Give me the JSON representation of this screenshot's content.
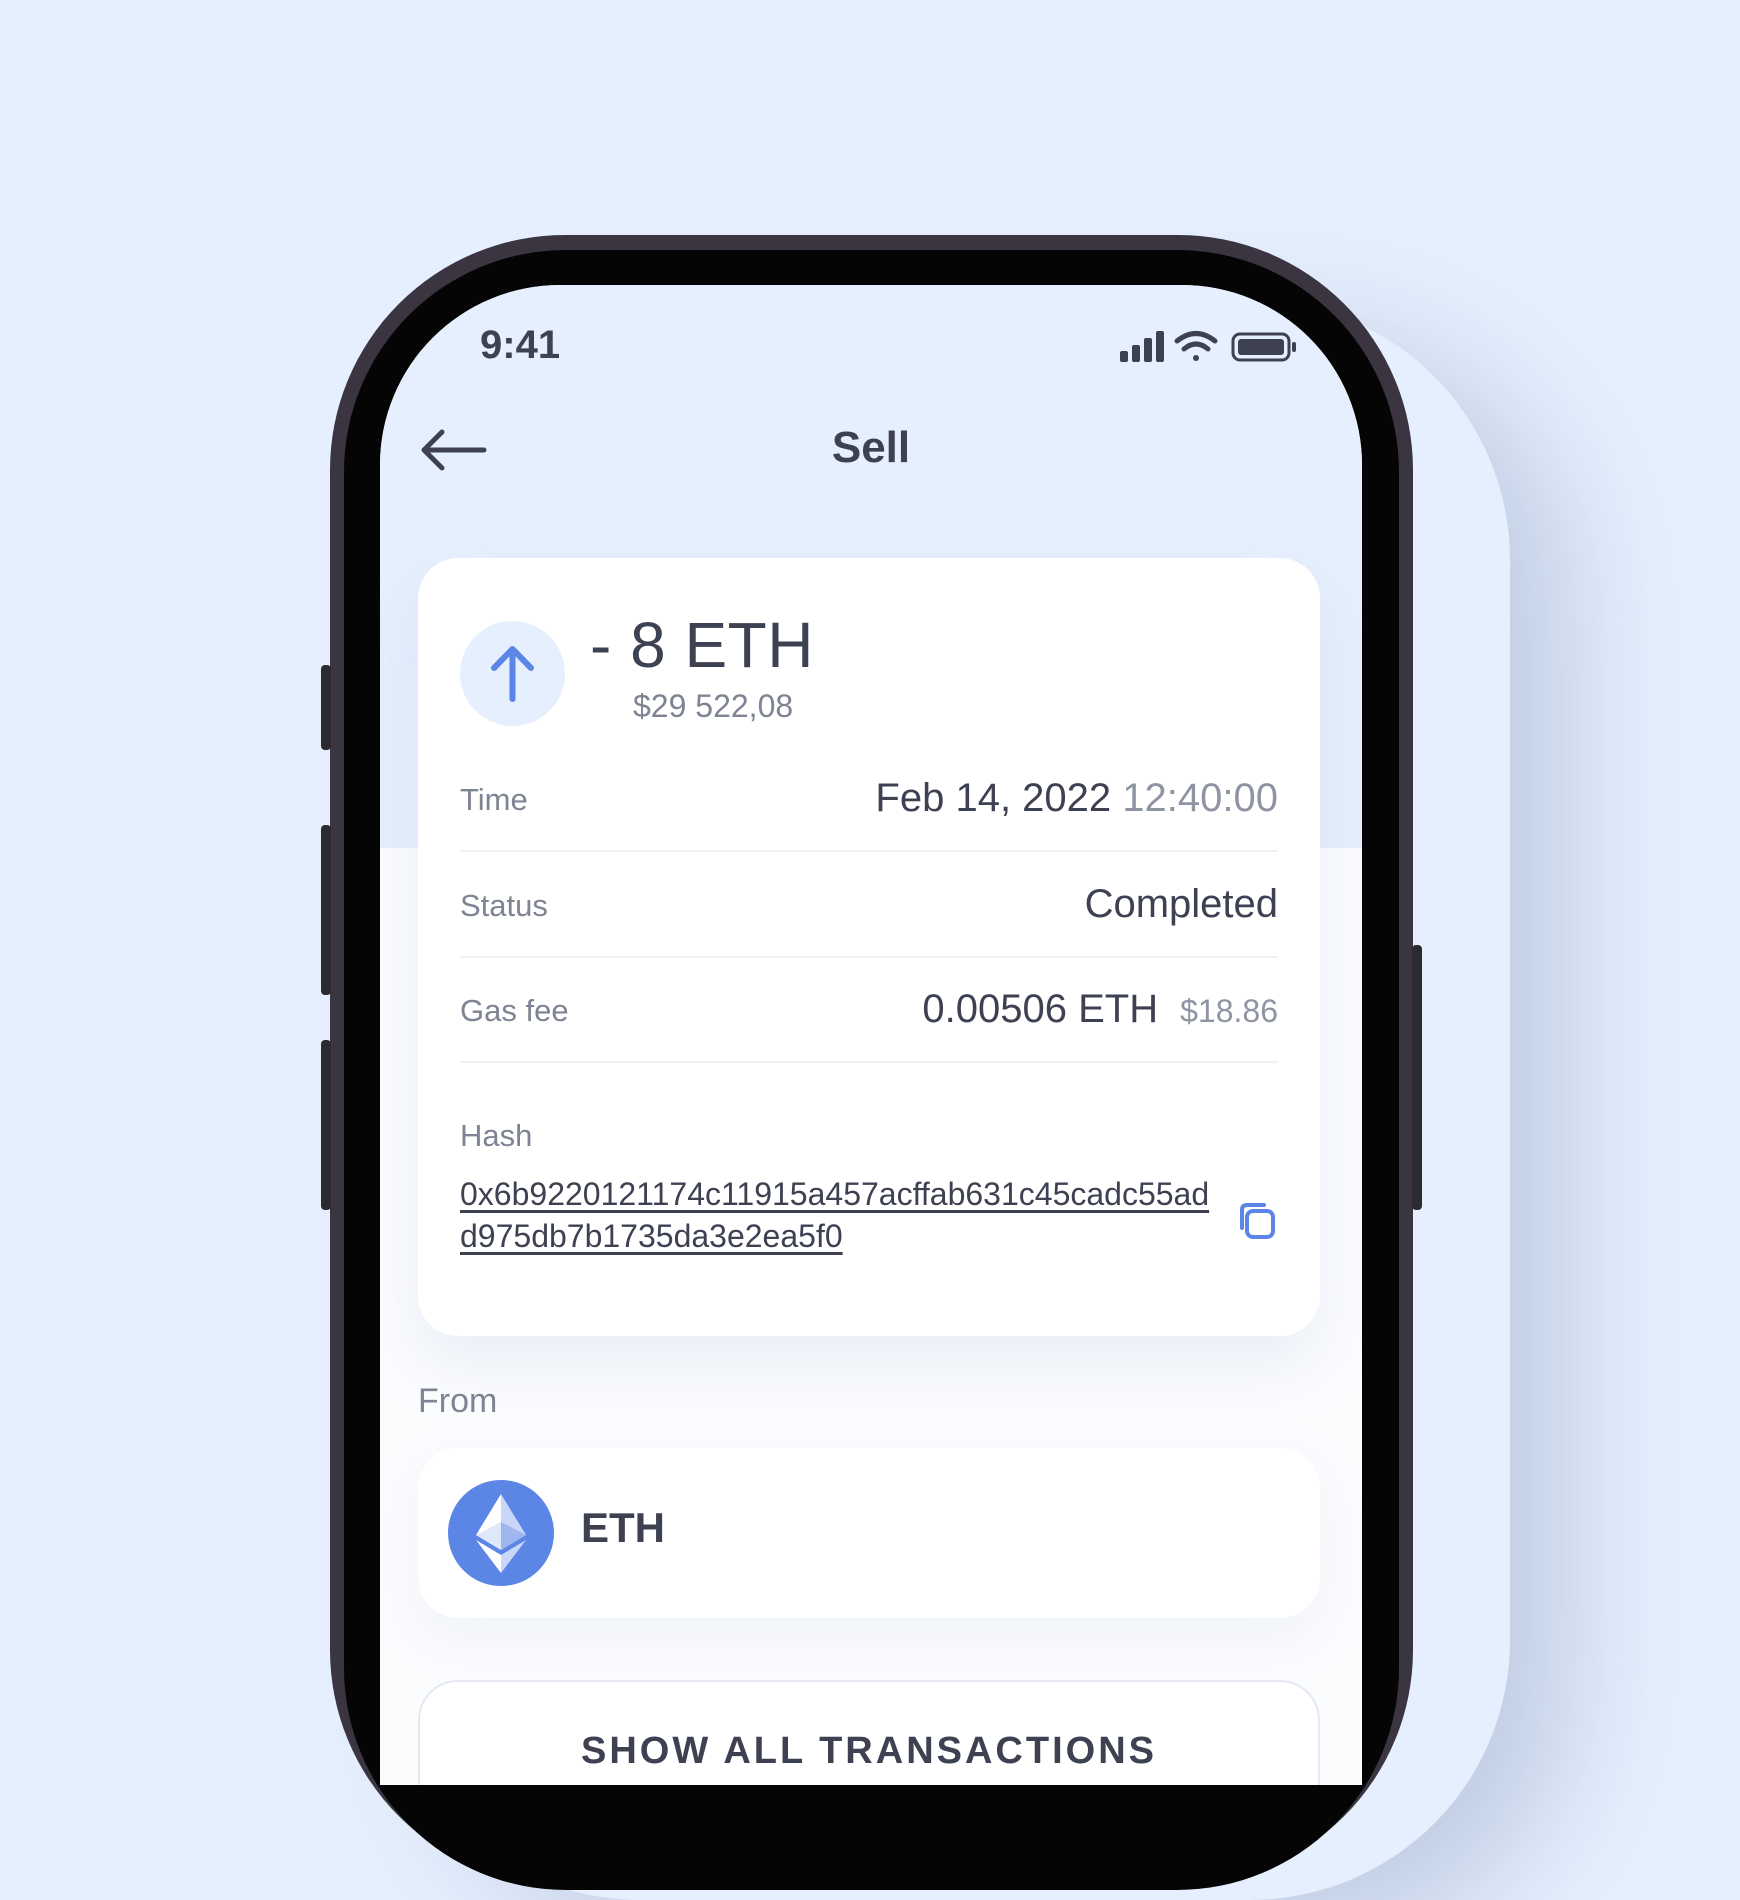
{
  "status_bar": {
    "time": "9:41"
  },
  "header": {
    "title": "Sell"
  },
  "transaction": {
    "amount": "- 8 ETH",
    "fiat_amount": "$29 522,08",
    "rows": {
      "time": {
        "label": "Time",
        "date": "Feb 14, 2022",
        "clock": "12:40:00"
      },
      "status": {
        "label": "Status",
        "value": "Completed"
      },
      "gas_fee": {
        "label": "Gas fee",
        "value": "0.00506 ETH",
        "fiat": "$18.86"
      }
    },
    "hash": {
      "label": "Hash",
      "value": "0x6b9220121174c11915a457acffab631c45cadc55add975db7b1735da3e2ea5f0"
    }
  },
  "from": {
    "label": "From",
    "asset": "ETH"
  },
  "footer": {
    "show_all_label": "SHOW ALL TRANSACTIONS"
  },
  "colors": {
    "background": "#e6effd",
    "accent": "#5b86e5",
    "text": "#3d4152",
    "muted": "#7f8494"
  },
  "icons": [
    "back-arrow-icon",
    "arrow-up-icon",
    "copy-icon",
    "ethereum-icon",
    "signal-icon",
    "wifi-icon",
    "battery-icon"
  ]
}
